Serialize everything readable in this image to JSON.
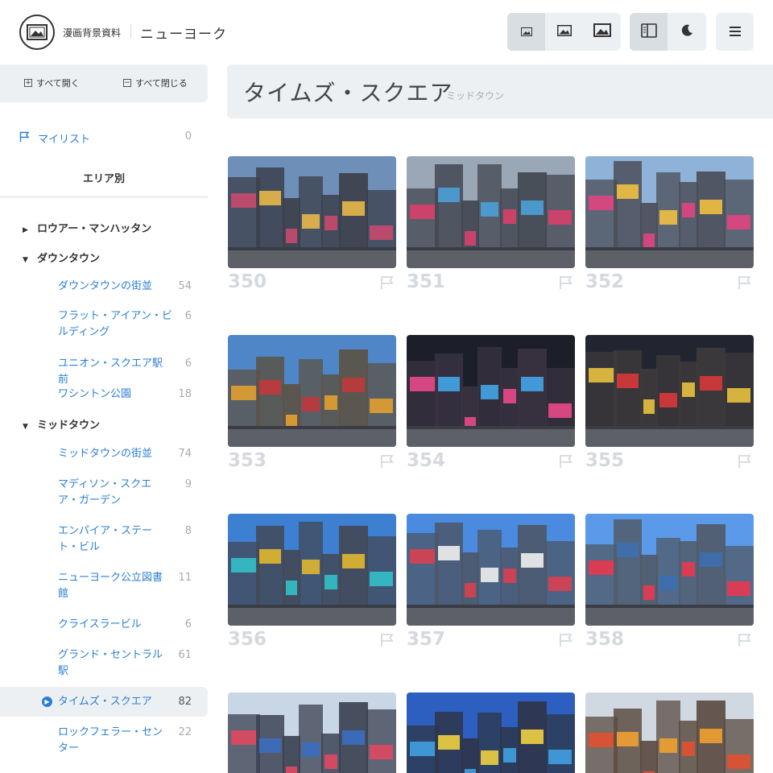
{
  "header": {
    "site_name": "漫画背景資料",
    "city": "ニューヨーク",
    "logo_icon": "picture-frame-icon",
    "size_buttons": [
      {
        "name": "small-thumbnails-button",
        "icon": "image-small-icon",
        "active": true
      },
      {
        "name": "medium-thumbnails-button",
        "icon": "image-medium-icon",
        "active": false
      },
      {
        "name": "large-thumbnails-button",
        "icon": "image-large-icon",
        "active": false
      }
    ],
    "view_buttons": [
      {
        "name": "sidebar-toggle-button",
        "icon": "sidebar-icon",
        "active": true
      },
      {
        "name": "dark-mode-button",
        "icon": "moon-icon",
        "active": false
      }
    ],
    "menu_icon": "hamburger-icon"
  },
  "sidebar": {
    "expand_all": "すべて開く",
    "collapse_all": "すべて閉じる",
    "mylist": {
      "label": "マイリスト",
      "count": "0",
      "icon": "flag-icon"
    },
    "area_heading": "エリア別",
    "groups": [
      {
        "label": "ロウアー・マンハッタン",
        "expanded": false
      },
      {
        "label": "ダウンタウン",
        "expanded": true
      },
      {
        "label": "ミッドタウン",
        "expanded": true
      }
    ],
    "items": [
      {
        "label": "ダウンタウンの街並",
        "count": "54"
      },
      {
        "label": "フラット・アイアン・ビルディング",
        "count": "6"
      },
      {
        "label": "ユニオン・スクエア駅前",
        "count": "6"
      },
      {
        "label": "ワシントン公園",
        "count": "18"
      },
      {
        "label": "ミッドタウンの街並",
        "count": "74"
      },
      {
        "label": "マディソン・スクエア・ガーデン",
        "count": "9"
      },
      {
        "label": "エンパイア・ステート・ビル",
        "count": "8"
      },
      {
        "label": "ニューヨーク公立図書館",
        "count": "11"
      },
      {
        "label": "クライスラービル",
        "count": "6"
      },
      {
        "label": "グランド・セントラル駅",
        "count": "61"
      },
      {
        "label": "タイムズ・スクエア",
        "count": "82",
        "selected": true
      },
      {
        "label": "ロックフェラー・センター",
        "count": "22"
      }
    ]
  },
  "main": {
    "title": "タイムズ・スクエア",
    "subtitle": "ミッドタウン",
    "photos": [
      {
        "number": "350"
      },
      {
        "number": "351"
      },
      {
        "number": "352"
      },
      {
        "number": "353"
      },
      {
        "number": "354"
      },
      {
        "number": "355"
      },
      {
        "number": "356"
      },
      {
        "number": "357"
      },
      {
        "number": "358"
      },
      {
        "number": ""
      },
      {
        "number": ""
      },
      {
        "number": ""
      }
    ]
  },
  "colors": {
    "accent": "#2a7fd4",
    "panel": "#edf0f3",
    "muted": "#d5d9de"
  }
}
